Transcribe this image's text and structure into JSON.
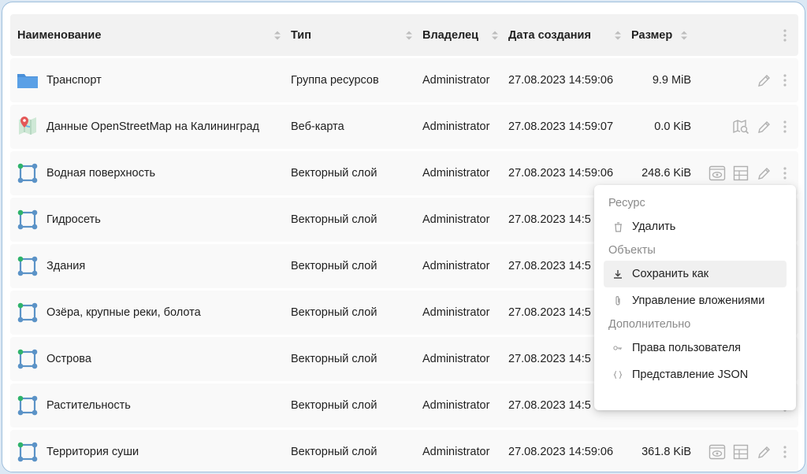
{
  "table": {
    "columns": [
      "Наименование",
      "Тип",
      "Владелец",
      "Дата создания",
      "Размер"
    ],
    "rows": [
      {
        "name": "Транспорт",
        "icon": "folder-icon",
        "type": "Группа ресурсов",
        "owner": "Administrator",
        "created": "27.08.2023 14:59:06",
        "size": "9.9 MiB",
        "actions": [
          "edit-icon"
        ]
      },
      {
        "name": "Данные OpenStreetMap на Калининград",
        "icon": "webmap-icon",
        "type": "Веб-карта",
        "owner": "Administrator",
        "created": "27.08.2023 14:59:07",
        "size": "0.0 KiB",
        "actions": [
          "map-search-icon",
          "edit-icon"
        ]
      },
      {
        "name": "Водная поверхность",
        "icon": "vector-layer-icon",
        "type": "Векторный слой",
        "owner": "Administrator",
        "created": "27.08.2023 14:59:06",
        "size": "248.6 KiB",
        "actions": [
          "preview-icon",
          "table-icon",
          "edit-icon"
        ]
      },
      {
        "name": "Гидросеть",
        "icon": "vector-layer-icon",
        "type": "Векторный слой",
        "owner": "Administrator",
        "created": "27.08.2023 14:5",
        "size": "",
        "actions": []
      },
      {
        "name": "Здания",
        "icon": "vector-layer-icon",
        "type": "Векторный слой",
        "owner": "Administrator",
        "created": "27.08.2023 14:5",
        "size": "",
        "actions": []
      },
      {
        "name": "Озёра, крупные реки, болота",
        "icon": "vector-layer-icon",
        "type": "Векторный слой",
        "owner": "Administrator",
        "created": "27.08.2023 14:5",
        "size": "",
        "actions": []
      },
      {
        "name": "Острова",
        "icon": "vector-layer-icon",
        "type": "Векторный слой",
        "owner": "Administrator",
        "created": "27.08.2023 14:5",
        "size": "",
        "actions": []
      },
      {
        "name": "Растительность",
        "icon": "vector-layer-icon",
        "type": "Векторный слой",
        "owner": "Administrator",
        "created": "27.08.2023 14:5",
        "size": "",
        "actions": []
      },
      {
        "name": "Территория суши",
        "icon": "vector-layer-icon",
        "type": "Векторный слой",
        "owner": "Administrator",
        "created": "27.08.2023 14:59:06",
        "size": "361.8 KiB",
        "actions": [
          "preview-icon",
          "table-icon",
          "edit-icon"
        ]
      }
    ]
  },
  "menu": {
    "group_resource": "Ресурс",
    "delete": "Удалить",
    "group_features": "Объекты",
    "save_as": "Сохранить как",
    "attachments": "Управление вложениями",
    "group_extra": "Дополнительно",
    "permissions": "Права пользователя",
    "json": "Представление JSON"
  },
  "colors": {
    "folder": "#4a90d9",
    "layer_node": "#5b93c7",
    "layer_node_accent": "#2fb36b",
    "icon_gray": "#9e9e9e"
  }
}
